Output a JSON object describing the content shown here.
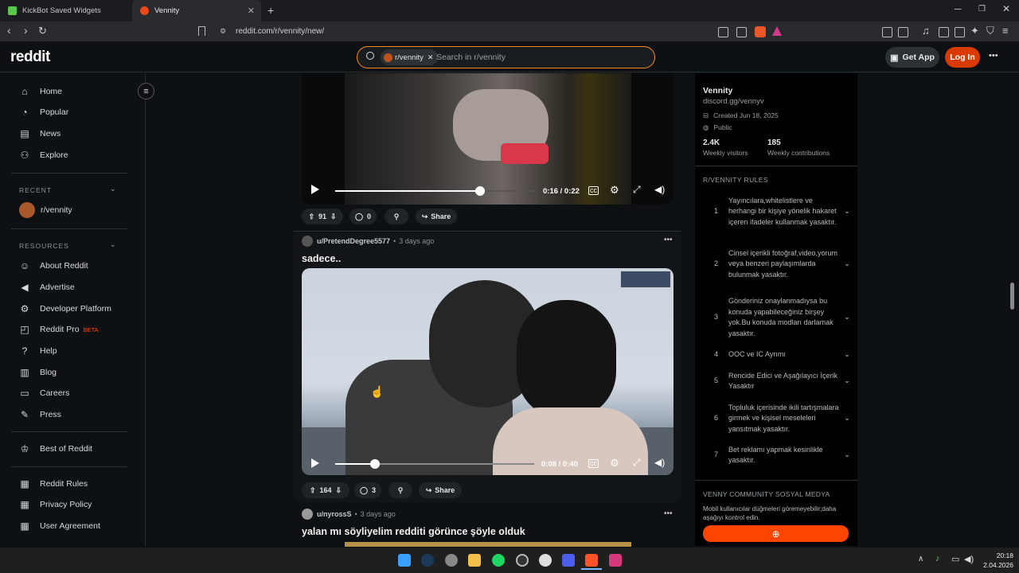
{
  "browser": {
    "tabs": [
      {
        "title": "KickBot Saved Widgets"
      },
      {
        "title": "Vennity"
      }
    ],
    "new_tab": "+",
    "url": "reddit.com/r/vennity/new/"
  },
  "header": {
    "logo": "reddit",
    "search_chip": "r/vennity",
    "search_chip_close": "✕",
    "search_placeholder": "Search in r/vennity",
    "get_app": "Get App",
    "login": "Log In",
    "more": "•••"
  },
  "left_nav": {
    "primary": [
      {
        "label": "Home",
        "icon": "home-icon"
      },
      {
        "label": "Popular",
        "icon": "popular-icon"
      },
      {
        "label": "News",
        "icon": "news-icon"
      },
      {
        "label": "Explore",
        "icon": "explore-icon"
      }
    ],
    "recent_header": "RECENT",
    "recent": [
      {
        "label": "r/vennity"
      }
    ],
    "resources_header": "RESOURCES",
    "resources": [
      {
        "label": "About Reddit"
      },
      {
        "label": "Advertise"
      },
      {
        "label": "Developer Platform"
      },
      {
        "label": "Reddit Pro",
        "badge": "BETA"
      },
      {
        "label": "Help"
      },
      {
        "label": "Blog"
      },
      {
        "label": "Careers"
      },
      {
        "label": "Press"
      }
    ],
    "best": "Best of Reddit",
    "legal": [
      {
        "label": "Reddit Rules"
      },
      {
        "label": "Privacy Policy"
      },
      {
        "label": "User Agreement"
      }
    ]
  },
  "posts": [
    {
      "time_display": "0:16 / 0:22",
      "progress": 0.727,
      "upvotes": "91",
      "comments": "0",
      "share": "Share"
    },
    {
      "author": "u/PretendDegree5577",
      "sep": "•",
      "age": "3 days ago",
      "title": "sadece..",
      "time_display": "0:08 / 0:40",
      "progress": 0.2,
      "upvotes": "164",
      "comments": "3",
      "share": "Share",
      "menu": "•••"
    },
    {
      "author": "u/nyrossS",
      "sep": "•",
      "age": "3 days ago",
      "title": "yalan mı söyliyelim redditi görünce şöyle olduk",
      "menu": "•••"
    }
  ],
  "community": {
    "name": "Vennity",
    "link": "discord.gg/vennyv",
    "created": "Created Jun 18, 2025",
    "visibility": "Public",
    "visitors": "2.4K",
    "visitors_label": "Weekly visitors",
    "contributions": "185",
    "contributions_label": "Weekly contributions",
    "rules_header": "R/VENNITY RULES",
    "rules": [
      {
        "n": "1",
        "text": "Yayıncılara,whitelistlere ve herhangi bir kişiye yönelik hakaret içeren ifadeler kullanmak yasaktır."
      },
      {
        "n": "2",
        "text": "Cinsel içerikli fotoğraf,video,yorum veya benzeri paylaşımlarda bulunmak yasaktır."
      },
      {
        "n": "3",
        "text": "Gönderiniz onaylanmadıysa bu konuda yapabileceğiniz birşey yok.Bu konuda modları darlamak yasaktır."
      },
      {
        "n": "4",
        "text": "OOC ve IC Ayrımı"
      },
      {
        "n": "5",
        "text": "Rencide Edici ve Aşağılayıcı İçerik Yasaktır"
      },
      {
        "n": "6",
        "text": "Topluluk içerisinde ikili tartışmalara girmek ve kişisel meseleleri yansıtmak yasaktır."
      },
      {
        "n": "7",
        "text": "Bet reklamı yapmak kesinlikle yasaktır."
      }
    ],
    "social_header": "VENNY COMMUNITY SOSYAL MEDYA",
    "social_note": "Mobil kullanıcılar düğmeleri göremeyebilir;daha aşağıyı kontrol edin."
  },
  "taskbar": {
    "time": "20:18",
    "date": "2.04.2026"
  },
  "colors": {
    "accent": "#d93a00",
    "search_border": "#ff8a1a"
  }
}
